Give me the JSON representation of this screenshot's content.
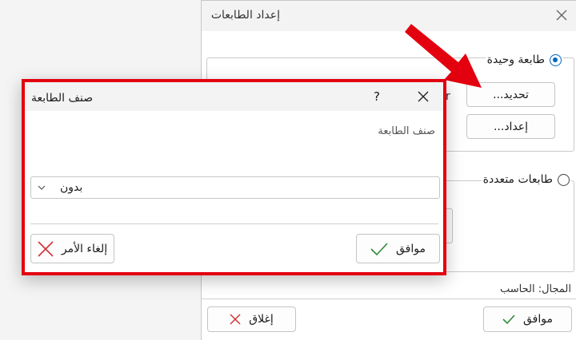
{
  "printer_setup_dialog": {
    "title": "إعداد الطابعات",
    "single_printer_label": "طابعة وحيدة",
    "multiple_printers_label": "طابعات متعددة",
    "select_button": "تحديد...",
    "setup_button": "إعداد...",
    "partial_char": "r",
    "scope_label": "المجال: الحاسب",
    "ok_button": "موافق",
    "close_button": "إغلاق"
  },
  "printer_class_dialog": {
    "title": "صنف الطابعة",
    "help_glyph": "?",
    "field_label": "صنف الطابعة",
    "selected_value": "بدون",
    "ok_button": "موافق",
    "cancel_button": "إلغاء الأمر"
  },
  "colors": {
    "highlight_frame": "#e3000f",
    "arrow": "#e3000f",
    "radio_accent": "#0067c0",
    "ok_check": "#2e8b3a",
    "cancel_x": "#d13438"
  }
}
